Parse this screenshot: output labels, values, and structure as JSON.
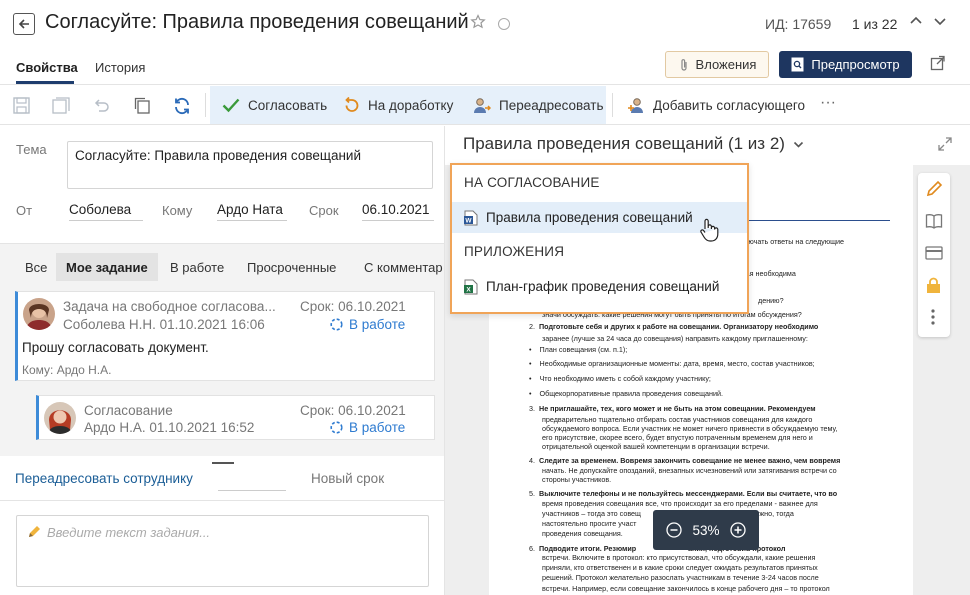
{
  "header": {
    "title": "Согласуйте: Правила проведения совещаний",
    "doc_id": "ИД: 17659",
    "counter": "1 из 22"
  },
  "tabs": [
    {
      "label": "Свойства",
      "active": true
    },
    {
      "label": "История",
      "active": false
    }
  ],
  "header_buttons": {
    "attachments": "Вложения",
    "preview": "Предпросмотр"
  },
  "toolbar": {
    "approve": "Согласовать",
    "rework": "На доработку",
    "redirect": "Переадресовать",
    "add_approver": "Добавить согласующего",
    "more": "···"
  },
  "form": {
    "topic_label": "Тема",
    "topic_value": "Согласуйте: Правила проведения совещаний",
    "from_label": "От",
    "from_value": "Соболева",
    "to_label": "Кому",
    "to_value": "Ардо Ната",
    "deadline_label": "Срок",
    "deadline_value": "06.10.2021"
  },
  "filter_tabs": [
    "Все",
    "Мое задание",
    "В работе",
    "Просроченные",
    "С комментар"
  ],
  "tasks": [
    {
      "title": "Задача на свободное согласова...",
      "deadline": "Срок: 06.10.2021",
      "author_date": "Соболева Н.Н.  01.10.2021 16:06",
      "status": "В работе",
      "message": "Прошу согласовать документ.",
      "recipient": "Кому: Ардо Н.А."
    },
    {
      "title": "Согласование",
      "deadline": "Срок: 06.10.2021",
      "author_date": "Ардо Н.А.  01.10.2021 16:52",
      "status": "В работе"
    }
  ],
  "bottom": {
    "redirect_link": "Переадресовать сотруднику",
    "new_deadline_placeholder": "Новый срок",
    "task_input_placeholder": "Введите текст задания..."
  },
  "doc_viewer": {
    "title": "Правила проведения совещаний (1 из 2)",
    "zoom": "53%",
    "page_lines": [
      {
        "text": "ключать ответы на следующие",
        "bold": false
      },
      {
        "text": ", какая необходима",
        "bold": false
      },
      {
        "text": "дению?",
        "bold": false
      },
      {
        "text": "значи обсуждать: какие решения могут быть приняты по итогам обсуждения?",
        "bold": false
      },
      {
        "text": "Подготовьте себя и других к работе на совещании. Организатору необходимо",
        "bold": true,
        "num": "2."
      },
      {
        "text": "заранее (лучше за 24 часа до совещания) направить каждому приглашенному:",
        "bold": false
      },
      {
        "text": "План совещания (см. п.1);",
        "bold": false,
        "bullet": true
      },
      {
        "text": "Необходимые организационные моменты: дата, время, место, состав участников;",
        "bold": false,
        "bullet": true
      },
      {
        "text": "Что необходимо иметь с собой каждому участнику;",
        "bold": false,
        "bullet": true
      },
      {
        "text": "Общекорпоративные правила проведения совещаний.",
        "bold": false,
        "bullet": true
      },
      {
        "text": "Не приглашайте, тех, кого может и не быть на этом совещании. Рекомендуем",
        "bold": true,
        "num": "3."
      },
      {
        "text": "предварительно тщательно отбирать состав участников совещания для каждого",
        "bold": false
      },
      {
        "text": "обсуждаемого вопроса. Если участник не может ничего привнести в обсуждаемую тему,",
        "bold": false
      },
      {
        "text": "его присутствие, скорее всего, будет впустую потраченным временем для него и",
        "bold": false
      },
      {
        "text": "отрицательной оценкой вашей компетенции в организации встречи.",
        "bold": false
      },
      {
        "text": "Следите за временем. Вовремя закончить совещание не менее важно, чем вовремя",
        "bold": true,
        "num": "4."
      },
      {
        "text": "начать. Не допускайте опозданий, внезапных исчезновений или затягивания встречи со",
        "bold": false
      },
      {
        "text": "стороны участников.",
        "bold": false
      },
      {
        "text": "Выключите телефоны и не пользуйтесь мессенджерами. Если вы считаете, что во",
        "bold": true,
        "num": "5."
      },
      {
        "text": "время проведения совещания все, что происходит за его пределами - важнее для",
        "bold": false
      },
      {
        "text": "участников – тогда это совещ                         е же оно все-таки нужно, тогда",
        "bold": false
      },
      {
        "text": "настоятельно просите участ                         ной связью в период",
        "bold": false
      },
      {
        "text": "проведения совещания.",
        "bold": false
      },
      {
        "text": "Подводите итоги. Резюмир                          ания, подготовив протокол",
        "bold": true,
        "num": "6."
      },
      {
        "text": "встречи. Включите в протокол: кто присутствовал, что обсуждали, какие решения",
        "bold": false
      },
      {
        "text": "приняли, кто ответственен и в какие сроки следует ожидать результатов принятых",
        "bold": false
      },
      {
        "text": "решений. Протокол желательно разослать участникам в течение 3-24 часов после",
        "bold": false
      },
      {
        "text": "встречи. Например, если совещание закончилось в конце рабочего дня – то протокол",
        "bold": false
      }
    ]
  },
  "dropdown": {
    "section1": "НА СОГЛАСОВАНИЕ",
    "item1": "Правила проведения совещаний",
    "section2": "ПРИЛОЖЕНИЯ",
    "item2": "План-график проведения совещаний"
  },
  "colors": {
    "accent": "#1e3660",
    "link": "#1a5d96",
    "highlight": "#e6f0fa",
    "dropdown_border": "#f0a458",
    "approve_green": "#3a9a3a",
    "rework_orange": "#e08a1e"
  }
}
